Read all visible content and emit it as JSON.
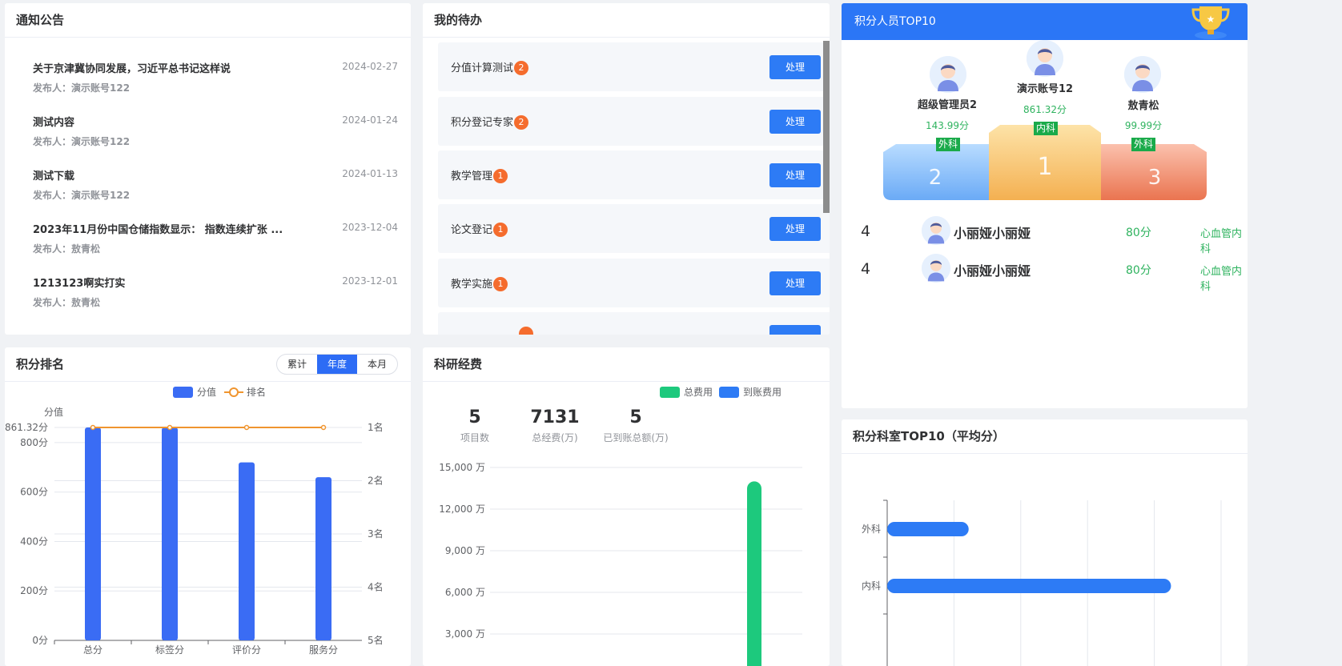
{
  "notice": {
    "title": "通知公告",
    "items": [
      {
        "title": "关于京津冀协同发展，习近平总书记这样说",
        "date": "2024-02-27",
        "publisher": "发布人：演示账号122"
      },
      {
        "title": "测试内容",
        "date": "2024-01-24",
        "publisher": "发布人：演示账号122"
      },
      {
        "title": "测试下载",
        "date": "2024-01-13",
        "publisher": "发布人：演示账号122"
      },
      {
        "title": "2023年11月份中国仓储指数显示： 指数连续扩张 ...",
        "date": "2023-12-04",
        "publisher": "发布人：敖青松"
      },
      {
        "title": "1213123啊实打实",
        "date": "2023-12-01",
        "publisher": "发布人：敖青松"
      }
    ]
  },
  "todo": {
    "title": "我的待办",
    "button_label": "处理",
    "items": [
      {
        "label": "分值计算测试",
        "count": "2"
      },
      {
        "label": "积分登记专家",
        "count": "2"
      },
      {
        "label": "教学管理",
        "count": "1"
      },
      {
        "label": "论文登记",
        "count": "1"
      },
      {
        "label": "教学实施",
        "count": "1"
      }
    ]
  },
  "top10": {
    "title": "积分人员TOP10",
    "podium": [
      {
        "rank": "2",
        "name": "超级管理员2",
        "score": "143.99分",
        "dept": "外科"
      },
      {
        "rank": "1",
        "name": "演示账号12",
        "score": "861.32分",
        "dept": "内科"
      },
      {
        "rank": "3",
        "name": "敖青松",
        "score": "99.99分",
        "dept": "外科"
      }
    ],
    "rows": [
      {
        "rank": "4",
        "name": "小丽娅小丽娅",
        "score": "80分",
        "dept": "心血管内科"
      },
      {
        "rank": "4",
        "name": "小丽娅小丽娅",
        "score": "80分",
        "dept": "心血管内科"
      }
    ]
  },
  "ranking": {
    "title": "积分排名",
    "tabs": [
      "累计",
      "年度",
      "本月"
    ],
    "active_tab": "年度",
    "legend": {
      "bar": "分值",
      "line": "排名"
    },
    "y_axis_name": "分值",
    "colors": {
      "bar": "#3a6cf4",
      "line": "#f0952f"
    }
  },
  "funding": {
    "title": "科研经费",
    "legend": {
      "total": "总费用",
      "arrived": "到账费用"
    },
    "stats": [
      {
        "value": "5",
        "label": "项目数"
      },
      {
        "value": "7131",
        "label": "总经费(万)"
      },
      {
        "value": "5",
        "label": "已到账总额(万)"
      }
    ],
    "colors": {
      "total": "#1dc97d",
      "arrived": "#2d7bf5"
    }
  },
  "dept_top10": {
    "title": "积分科室TOP10（平均分）",
    "color": "#2d7bf5"
  },
  "chart_data": [
    {
      "type": "bar",
      "title": "积分排名",
      "categories": [
        "总分",
        "标签分",
        "评价分",
        "服务分"
      ],
      "series": [
        {
          "name": "分值",
          "type": "bar",
          "values": [
            861.32,
            861.32,
            720,
            660
          ]
        },
        {
          "name": "排名",
          "type": "line",
          "values": [
            1,
            1,
            1,
            1
          ]
        }
      ],
      "ylabel": "分值",
      "y_ticks": [
        "0分",
        "200分",
        "400分",
        "600分",
        "800分",
        "861.32分"
      ],
      "y2_ticks": [
        "1名",
        "2名",
        "3名",
        "4名",
        "5名"
      ],
      "ylim": [
        0,
        861.32
      ],
      "y2lim": [
        1,
        5
      ]
    },
    {
      "type": "bar",
      "title": "科研经费",
      "series": [
        {
          "name": "总费用",
          "values": [
            14000
          ]
        },
        {
          "name": "到账费用",
          "values": []
        }
      ],
      "y_ticks": [
        "3,000 万",
        "6,000 万",
        "9,000 万",
        "12,000 万",
        "15,000 万"
      ],
      "ylim": [
        0,
        15000
      ]
    },
    {
      "type": "bar",
      "title": "积分科室TOP10（平均分）",
      "orientation": "horizontal",
      "categories": [
        "外科",
        "内科"
      ],
      "values": [
        121.99,
        425
      ]
    }
  ]
}
